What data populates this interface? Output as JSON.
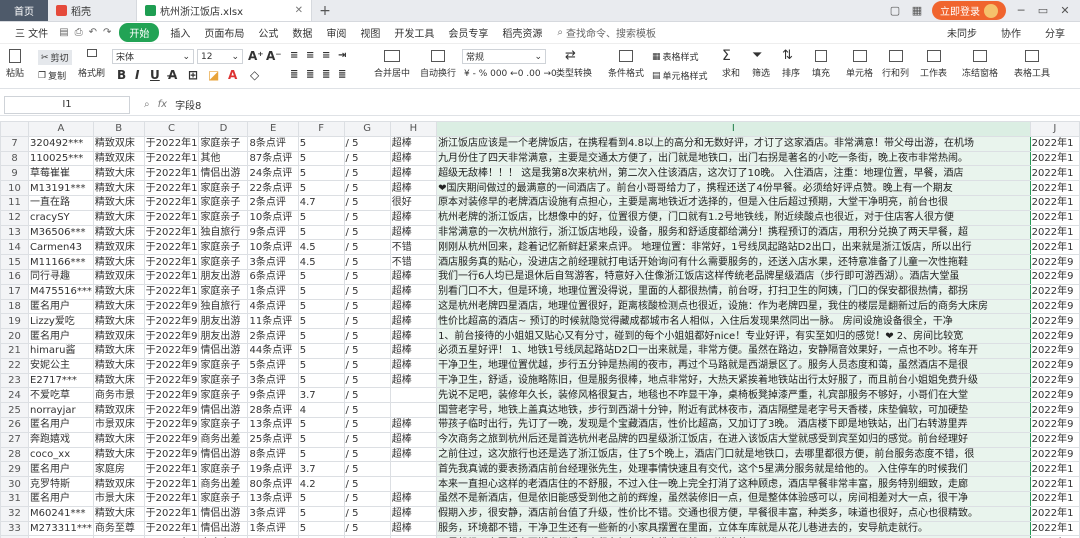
{
  "tabs": {
    "home": "首页",
    "doc": "稻壳",
    "file": "杭州浙江饭店.xlsx"
  },
  "topright": {
    "login": "立即登录"
  },
  "menu": {
    "file": "三 文件",
    "start": "开始",
    "items": [
      "插入",
      "页面布局",
      "公式",
      "数据",
      "审阅",
      "视图",
      "开发工具",
      "会员专享",
      "稻壳资源"
    ],
    "search": "查找命令、搜索模板",
    "right": [
      "未同步",
      "协作",
      "分享"
    ]
  },
  "ribbon": {
    "paste": "粘贴",
    "cut": "剪切",
    "copy": "复制",
    "format_painter": "格式刷",
    "font_name": "宋体",
    "font_size": "12",
    "merge": "合并居中",
    "wrap": "自动换行",
    "number_format": "常规",
    "type_convert": "类型转换",
    "conditional": "条件格式",
    "table_style": "表格样式",
    "cell_style": "单元格样式",
    "sum": "求和",
    "filter": "筛选",
    "sort": "排序",
    "fill": "填充",
    "cell": "单元格",
    "rowcol": "行和列",
    "worksheet": "工作表",
    "freeze": "冻结窗格",
    "table_tools": "表格工具"
  },
  "formula": {
    "cell_ref": "I1",
    "content": "字段8"
  },
  "columns": [
    "A",
    "B",
    "C",
    "D",
    "E",
    "F",
    "G",
    "H",
    "I",
    "J"
  ],
  "rows": [
    {
      "n": "7",
      "a": "320492***",
      "b": "精致双床",
      "c": "于2022年1",
      "d": "家庭亲子",
      "e": "8条点评",
      "f": "5",
      "g": "/ 5",
      "h": "超棒",
      "i": "浙江饭店应该是一个老牌饭店，在携程看到4.8以上的高分和无数好评，才订了这家酒店。非常满意！带父母出游，在机场",
      "j": "2022年1"
    },
    {
      "n": "8",
      "a": "110025***",
      "b": "精致双床",
      "c": "于2022年1",
      "d": "其他",
      "e": "87条点评",
      "f": "5",
      "g": "/ 5",
      "h": "超棒",
      "i": "九月份住了四天非常满意，主要是交通太方便了，出门就是地铁口，出门右拐是著名的小吃一条街，晚上夜市非常热闹。",
      "j": "2022年1"
    },
    {
      "n": "9",
      "a": "草莓崔崔",
      "b": "精致大床",
      "c": "于2022年1",
      "d": "情侣出游",
      "e": "24条点评",
      "f": "5",
      "g": "/ 5",
      "h": "超棒",
      "i": "超级无敌棒！！！ 这是我第8次来杭州，第二次入住该酒店，这次订了10晚。 入住酒店，注重：地理位置，早餐，酒店",
      "j": "2022年1"
    },
    {
      "n": "10",
      "a": "M13191***",
      "b": "精致大床",
      "c": "于2022年1",
      "d": "家庭亲子",
      "e": "22条点评",
      "f": "5",
      "g": "/ 5",
      "h": "超棒",
      "i": "❤国庆期间做过的最满意的一间酒店了。前台小哥哥给力了，携程还送了4份早餐。必须给好评点赞。晚上有一个期友",
      "j": "2022年1"
    },
    {
      "n": "11",
      "a": "一直在路",
      "b": "精致大床",
      "c": "于2022年1",
      "d": "家庭亲子",
      "e": "2条点评",
      "f": "4.7",
      "g": "/ 5",
      "h": "很好",
      "i": "原本对装修早的老牌酒店设施有点担心，主要是离地铁近才选择的，但是入住后超过预期，大堂干净明亮，前台也很",
      "j": "2022年1"
    },
    {
      "n": "12",
      "a": "cracySY",
      "b": "精致大床",
      "c": "于2022年1",
      "d": "家庭亲子",
      "e": "10条点评",
      "f": "5",
      "g": "/ 5",
      "h": "超棒",
      "i": "杭州老牌的浙江饭店，比想像中的好，位置很方便，门口就有1.2号地铁线，附近续酸点也很近，对于住店客人很方便",
      "j": "2022年1"
    },
    {
      "n": "13",
      "a": "M36506***",
      "b": "精致大床",
      "c": "于2022年1",
      "d": "独自旅行",
      "e": "9条点评",
      "f": "5",
      "g": "/ 5",
      "h": "超棒",
      "i": "非常满意的一次杭州旅行，浙江饭店地段，设备，服务和舒适度都给满分！携程预订的酒店，用积分兑换了两天早餐，超",
      "j": "2022年1"
    },
    {
      "n": "14",
      "a": "Carmen43",
      "b": "精致双床",
      "c": "于2022年1",
      "d": "家庭亲子",
      "e": "10条点评",
      "f": "4.5",
      "g": "/ 5",
      "h": "不错",
      "i": "刚刚从杭州回来，趁着记忆新鲜赶紧来点评。 地理位置：非常好，1号线凤起路站D2出口，出来就是浙江饭店，所以出行",
      "j": "2022年1"
    },
    {
      "n": "15",
      "a": "M11166***",
      "b": "精致大床",
      "c": "于2022年1",
      "d": "家庭亲子",
      "e": "3条点评",
      "f": "4.5",
      "g": "/ 5",
      "h": "不错",
      "i": "酒店服务真的贴心，没进店之前经理就打电话开始询问有什么需要服务的，还送入店水果，还特意准备了儿童一次性拖鞋",
      "j": "2022年9"
    },
    {
      "n": "16",
      "a": "同行寻趣",
      "b": "精致双床",
      "c": "于2022年1",
      "d": "朋友出游",
      "e": "6条点评",
      "f": "5",
      "g": "/ 5",
      "h": "超棒",
      "i": "我们一行6人均已是退休后自驾游客，特意好入住像浙江饭店这样传统老品牌星级酒店（步行即可游西湖）。酒店大堂虽",
      "j": "2022年9"
    },
    {
      "n": "17",
      "a": "M475516***",
      "b": "精致大床",
      "c": "于2022年1",
      "d": "家庭亲子",
      "e": "1条点评",
      "f": "5",
      "g": "/ 5",
      "h": "超棒",
      "i": "别看门口不大，但是环境，地理位置没得说，里面的人都很热情，前台呀，打扫卫生的阿姨，门口的保安都很热情，都拐",
      "j": "2022年9"
    },
    {
      "n": "18",
      "a": "匿名用户",
      "b": "精致大床",
      "c": "于2022年9",
      "d": "独自旅行",
      "e": "4条点评",
      "f": "5",
      "g": "/ 5",
      "h": "超棒",
      "i": "这是杭州老牌四星酒店，地理位置很好，距离核酸检测点也很近，设施：作为老牌四星，我住的楼层是翻新过后的商务大床房",
      "j": "2022年9"
    },
    {
      "n": "19",
      "a": "Lizzy爱吃",
      "b": "精致大床",
      "c": "于2022年9",
      "d": "朋友出游",
      "e": "11条点评",
      "f": "5",
      "g": "/ 5",
      "h": "超棒",
      "i": "性价比超高的酒店~ 预订的时候就隐觉得藏成都城市名人相似，入住后发现果然同出一脉。 房间设施设备很全，干净",
      "j": "2022年9"
    },
    {
      "n": "20",
      "a": "匿名用户",
      "b": "精致双床",
      "c": "于2022年9",
      "d": "朋友出游",
      "e": "2条点评",
      "f": "5",
      "g": "/ 5",
      "h": "超棒",
      "i": "1、前台接待的小姐姐又贴心又有分寸，碰到的每个小姐姐都好nice！专业好评，有实至如归的感觉！❤ 2、房间比较宽",
      "j": "2022年9"
    },
    {
      "n": "21",
      "a": "himaru酱",
      "b": "精致大床",
      "c": "于2022年9",
      "d": "情侣出游",
      "e": "44条点评",
      "f": "5",
      "g": "/ 5",
      "h": "超棒",
      "i": "必须五星好评！ 1、地铁1号线凤起路站D2口一出来就是，非常方便。虽然在路边，安静隔音效果好，一点也不吵。将车开",
      "j": "2022年9"
    },
    {
      "n": "22",
      "a": "安妮公主",
      "b": "精致大床",
      "c": "于2022年9",
      "d": "家庭亲子",
      "e": "5条点评",
      "f": "5",
      "g": "/ 5",
      "h": "超棒",
      "i": "干净卫生，地理位置优越，步行五分钟是热闹的夜市，再过个马路就是西湖景区了。服务人员态度和蔼，虽然酒店不是很",
      "j": "2022年9"
    },
    {
      "n": "23",
      "a": "E2717***",
      "b": "精致大床",
      "c": "于2022年9",
      "d": "家庭亲子",
      "e": "3条点评",
      "f": "5",
      "g": "/ 5",
      "h": "超棒",
      "i": "干净卫生，舒适，设施略陈旧，但是服务很棒，地点非常好，大热天紧挨着地铁站出行太好服了，而且前台小姐姐免费升级",
      "j": "2022年9"
    },
    {
      "n": "24",
      "a": "不爱吃草",
      "b": "商务市景",
      "c": "于2022年9",
      "d": "家庭亲子",
      "e": "9条点评",
      "f": "3.7",
      "g": "/ 5",
      "h": "",
      "i": "先说不足吧，装修年久长，装修风格很复古，地毯也不咋显干净，桌椅板凳掉漆严重，礼宾部服务不够好，小哥们在大堂",
      "j": "2022年9"
    },
    {
      "n": "25",
      "a": "norrayjar",
      "b": "精致双床",
      "c": "于2022年9",
      "d": "情侣出游",
      "e": "28条点评",
      "f": "4",
      "g": "/ 5",
      "h": "",
      "i": "国营老字号，地铁上盖真达地铁，步行到西湖十分钟，附近有武林夜市，酒店隔壁是老字号天香楼，床垫偏软，可加硬垫",
      "j": "2022年9"
    },
    {
      "n": "26",
      "a": "匿名用户",
      "b": "市景双床",
      "c": "于2022年9",
      "d": "家庭亲子",
      "e": "13条点评",
      "f": "5",
      "g": "/ 5",
      "h": "超棒",
      "i": "带孩子临时出行，先订了一晚，发现是个宝藏酒店，性价比超高，又加订了3晚。 酒店楼下即是地铁站，出门右转游里弄",
      "j": "2022年9"
    },
    {
      "n": "27",
      "a": "奔跑嬉戏",
      "b": "精致大床",
      "c": "于2022年9",
      "d": "商务出差",
      "e": "25条点评",
      "f": "5",
      "g": "/ 5",
      "h": "超棒",
      "i": "今次商务之旅到杭州后还是首选杭州老品牌的四星级浙江饭店，在进入该饭店大堂就感受到宾至如归的感觉。前台经理好",
      "j": "2022年9"
    },
    {
      "n": "28",
      "a": "coco_xx",
      "b": "精致大床",
      "c": "于2022年9",
      "d": "情侣出游",
      "e": "8条点评",
      "f": "5",
      "g": "/ 5",
      "h": "超棒",
      "i": "之前住过，这次旅行也还是选了浙江饭店，住了5个晚上，酒店门口就是地铁口，去哪里都很方便，前台服务态度不错，很",
      "j": "2022年9"
    },
    {
      "n": "29",
      "a": "匿名用户",
      "b": "家庭房",
      "c": "于2022年1",
      "d": "家庭亲子",
      "e": "19条点评",
      "f": "3.7",
      "g": "/ 5",
      "h": "",
      "i": "首先我真诚的要表扬酒店前台经理张先生，处理事情快速且有交代，这个5星满分服务就是给他的。 入住停车的时候我们",
      "j": "2022年1"
    },
    {
      "n": "30",
      "a": "克罗特斯",
      "b": "精致双床",
      "c": "于2022年1",
      "d": "商务出差",
      "e": "80条点评",
      "f": "4.2",
      "g": "/ 5",
      "h": "",
      "i": "本来一直担心这样的老酒店住的不舒服，不过入住一晚上完全打消了这种顾虑，酒店早餐非常丰富，服务特别细致，走廊",
      "j": "2022年1"
    },
    {
      "n": "31",
      "a": "匿名用户",
      "b": "市景大床",
      "c": "于2022年1",
      "d": "家庭亲子",
      "e": "13条点评",
      "f": "5",
      "g": "/ 5",
      "h": "超棒",
      "i": "虽然不是新酒店，但是依旧能感受到他之前的辉煌，虽然装修旧一点，但是整体体验感可以，房间相差对大一点，很干净",
      "j": "2022年1"
    },
    {
      "n": "32",
      "a": "M60241***",
      "b": "精致大床",
      "c": "于2022年1",
      "d": "情侣出游",
      "e": "3条点评",
      "f": "5",
      "g": "/ 5",
      "h": "超棒",
      "i": "假期入步，很安静，酒店前台值了升级，性价比不错。交通也很方便，早餐很丰富，种类多，味道也很好，点心也很精致。",
      "j": "2022年1"
    },
    {
      "n": "33",
      "a": "M273311***",
      "b": "商务至尊",
      "c": "于2022年1",
      "d": "情侣出游",
      "e": "1条点评",
      "f": "5",
      "g": "/ 5",
      "h": "超棒",
      "i": "服务，环境都不错，干净卫生还有一些新的小家具摆置在里面，立体车库就是从花儿巷进去的，安导航走就行。",
      "j": "2022年1"
    },
    {
      "n": "34",
      "a": "1/8***",
      "b": "",
      "c": "于2022年1",
      "d": "家庭亲子",
      "e": "",
      "f": "",
      "g": "",
      "h": "",
      "i": "不是机场，主要是离西湖步行近，出租车好打，安排上早就可以进去的。",
      "j": "2022年1"
    }
  ]
}
